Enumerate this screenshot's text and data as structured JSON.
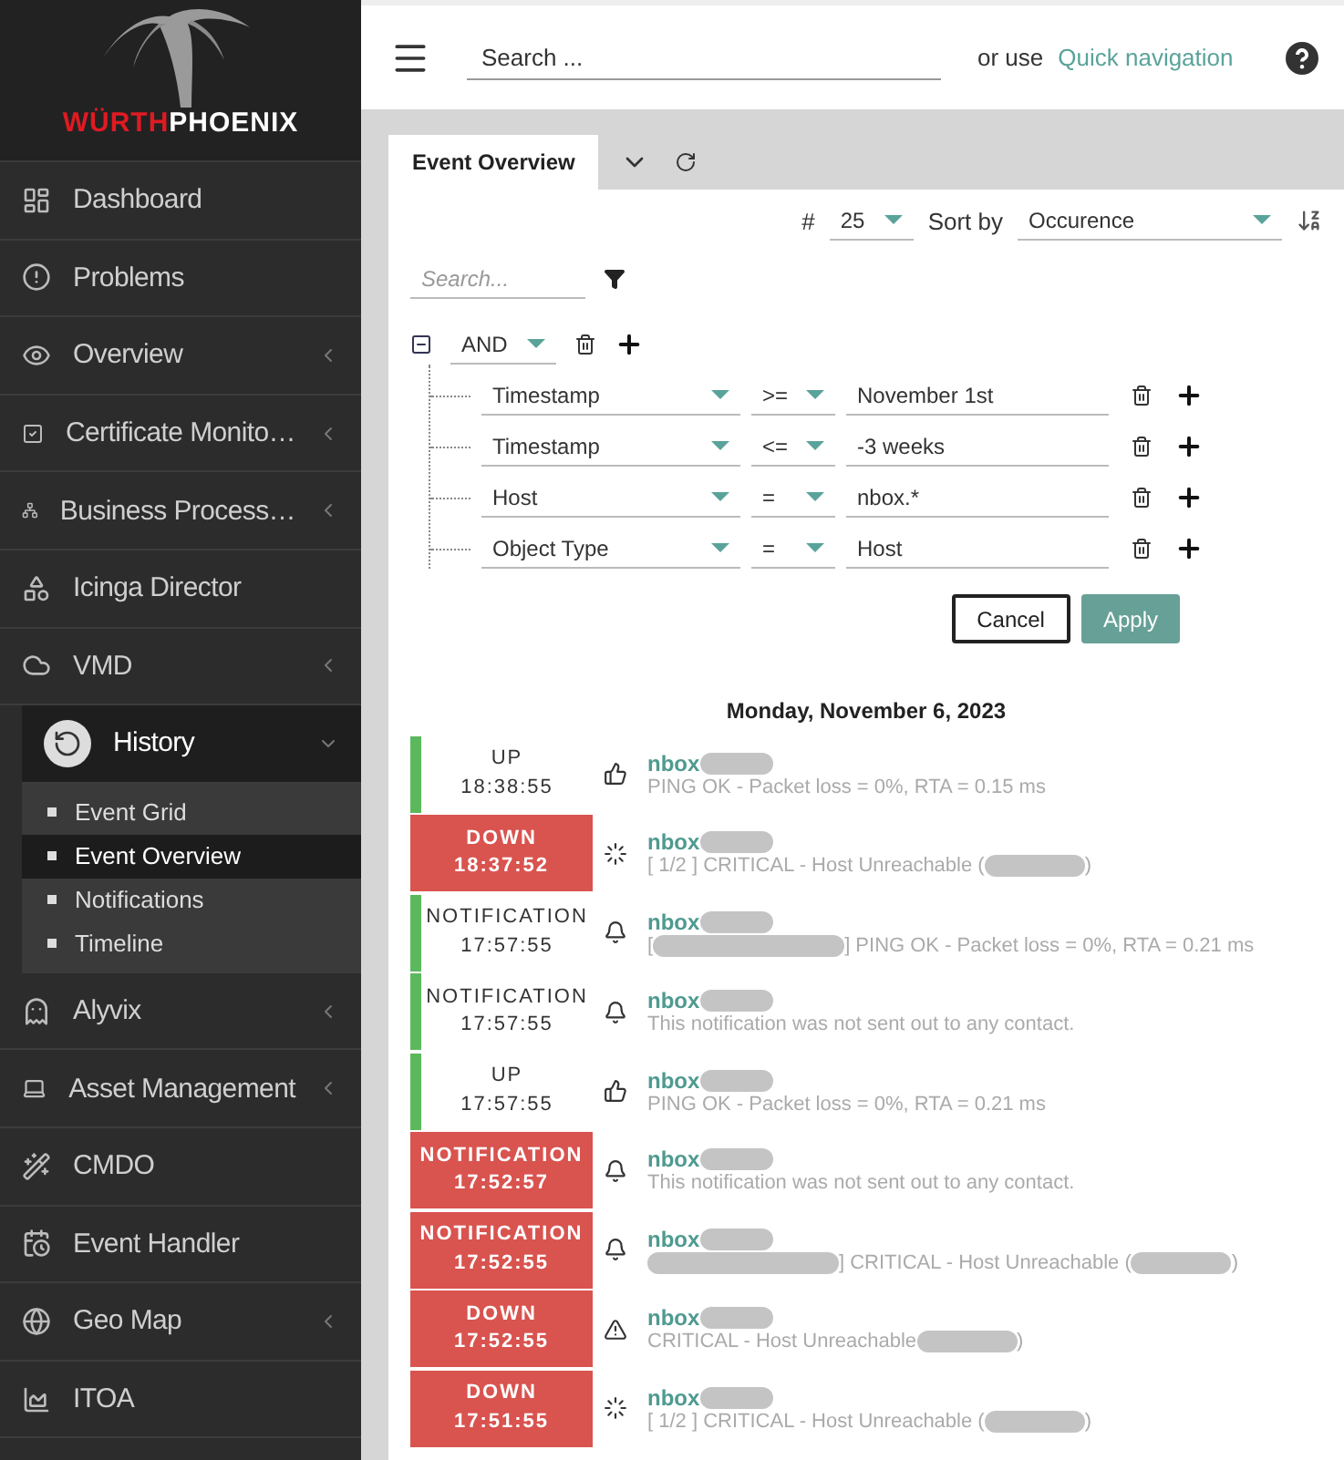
{
  "logo": {
    "part_1": "WÜRTH",
    "part_2": "PHOENIX"
  },
  "sidebar": {
    "items": [
      {
        "kind": "dashboard",
        "label": "Dashboard",
        "has_submenu": false
      },
      {
        "kind": "problems",
        "label": "Problems",
        "has_submenu": false
      },
      {
        "kind": "overview",
        "label": "Overview",
        "has_submenu": true
      },
      {
        "kind": "certificate",
        "label": "Certificate Monito…",
        "has_submenu": true
      },
      {
        "kind": "business",
        "label": "Business Process…",
        "has_submenu": true
      },
      {
        "kind": "director",
        "label": "Icinga Director",
        "has_submenu": false
      },
      {
        "kind": "cloud",
        "label": "VMD",
        "has_submenu": true
      },
      {
        "kind": "history",
        "label": "History",
        "has_submenu": true,
        "expanded": true,
        "children": [
          {
            "label": "Event Grid",
            "selected": false
          },
          {
            "label": "Event Overview",
            "selected": true
          },
          {
            "label": "Notifications",
            "selected": false
          },
          {
            "label": "Timeline",
            "selected": false
          }
        ]
      },
      {
        "kind": "alien",
        "label": "Alyvix",
        "has_submenu": true
      },
      {
        "kind": "laptop",
        "label": "Asset Management",
        "has_submenu": true
      },
      {
        "kind": "wand",
        "label": "CMDO",
        "has_submenu": false
      },
      {
        "kind": "calendar",
        "label": "Event Handler",
        "has_submenu": false
      },
      {
        "kind": "globe",
        "label": "Geo Map",
        "has_submenu": true
      },
      {
        "kind": "chart",
        "label": "ITOA",
        "has_submenu": false
      }
    ]
  },
  "topbar": {
    "search_placeholder": "Search ...",
    "or_use": "or use",
    "quick_navigation": "Quick navigation"
  },
  "tabs": [
    {
      "label": "Event Overview",
      "selected": true
    }
  ],
  "toolbar": {
    "hash": "#",
    "limit": "25",
    "sort_by": "Sort by",
    "sort_field": "Occurence"
  },
  "filter": {
    "search_placeholder": "Search...",
    "operator": "AND",
    "rules": [
      {
        "field": "Timestamp",
        "op": ">=",
        "value": "November 1st"
      },
      {
        "field": "Timestamp",
        "op": "<=",
        "value": "-3 weeks"
      },
      {
        "field": "Host",
        "op": "=",
        "value": "nbox.*"
      },
      {
        "field": "Object Type",
        "op": "=",
        "value": "Host"
      }
    ],
    "cancel": "Cancel",
    "apply": "Apply"
  },
  "date_heading": "Monday, November 6, 2023",
  "events": [
    {
      "kind": "ok",
      "status": "UP",
      "time": "18:38:55",
      "icon": {
        "kind": "thumb"
      },
      "host": "nbox",
      "message": [
        {
          "kind": "text",
          "text": "PING OK - Packet loss = 0%, RTA = 0.15 ms"
        }
      ]
    },
    {
      "kind": "problem",
      "status": "DOWN",
      "time": "18:37:52",
      "icon": {
        "kind": "pending"
      },
      "host": "nbox",
      "message": [
        {
          "kind": "text",
          "text": "[ 1/2 ] CRITICAL - Host Unreachable ("
        },
        {
          "kind": "redacted"
        },
        {
          "kind": "text",
          "text": ")"
        }
      ]
    },
    {
      "kind": "ok",
      "status": "NOTIFICATION",
      "time": "17:57:55",
      "icon": {
        "kind": "bell"
      },
      "host": "nbox",
      "message": [
        {
          "kind": "text",
          "text": "["
        },
        {
          "kind": "redacted",
          "wide": true
        },
        {
          "kind": "text",
          "text": "] PING OK - Packet loss = 0%, RTA = 0.21 ms"
        }
      ]
    },
    {
      "kind": "ok",
      "status": "NOTIFICATION",
      "time": "17:57:55",
      "icon": {
        "kind": "bell"
      },
      "host": "nbox",
      "message": [
        {
          "kind": "text",
          "text": "This notification was not sent out to any contact."
        }
      ]
    },
    {
      "kind": "ok",
      "status": "UP",
      "time": "17:57:55",
      "icon": {
        "kind": "thumb"
      },
      "host": "nbox",
      "message": [
        {
          "kind": "text",
          "text": "PING OK - Packet loss = 0%, RTA = 0.21 ms"
        }
      ]
    },
    {
      "kind": "problem",
      "status": "NOTIFICATION",
      "time": "17:52:57",
      "icon": {
        "kind": "bell"
      },
      "host": "nbox",
      "message": [
        {
          "kind": "text",
          "text": "This notification was not sent out to any contact."
        }
      ]
    },
    {
      "kind": "problem",
      "status": "NOTIFICATION",
      "time": "17:52:55",
      "icon": {
        "kind": "bell"
      },
      "host": "nbox",
      "message": [
        {
          "kind": "redacted",
          "wide": true
        },
        {
          "kind": "text",
          "text": "] CRITICAL - Host Unreachable ("
        },
        {
          "kind": "redacted"
        },
        {
          "kind": "text",
          "text": ")"
        }
      ]
    },
    {
      "kind": "problem",
      "status": "DOWN",
      "time": "17:52:55",
      "icon": {
        "kind": "warning"
      },
      "host": "nbox",
      "message": [
        {
          "kind": "text",
          "text": "CRITICAL - Host Unreachable "
        },
        {
          "kind": "redacted"
        },
        {
          "kind": "text",
          "text": ")"
        }
      ]
    },
    {
      "kind": "problem",
      "status": "DOWN",
      "time": "17:51:55",
      "icon": {
        "kind": "pending"
      },
      "host": "nbox",
      "message": [
        {
          "kind": "text",
          "text": "[ 1/2 ] CRITICAL - Host Unreachable ("
        },
        {
          "kind": "redacted"
        },
        {
          "kind": "text",
          "text": ")"
        }
      ]
    }
  ]
}
